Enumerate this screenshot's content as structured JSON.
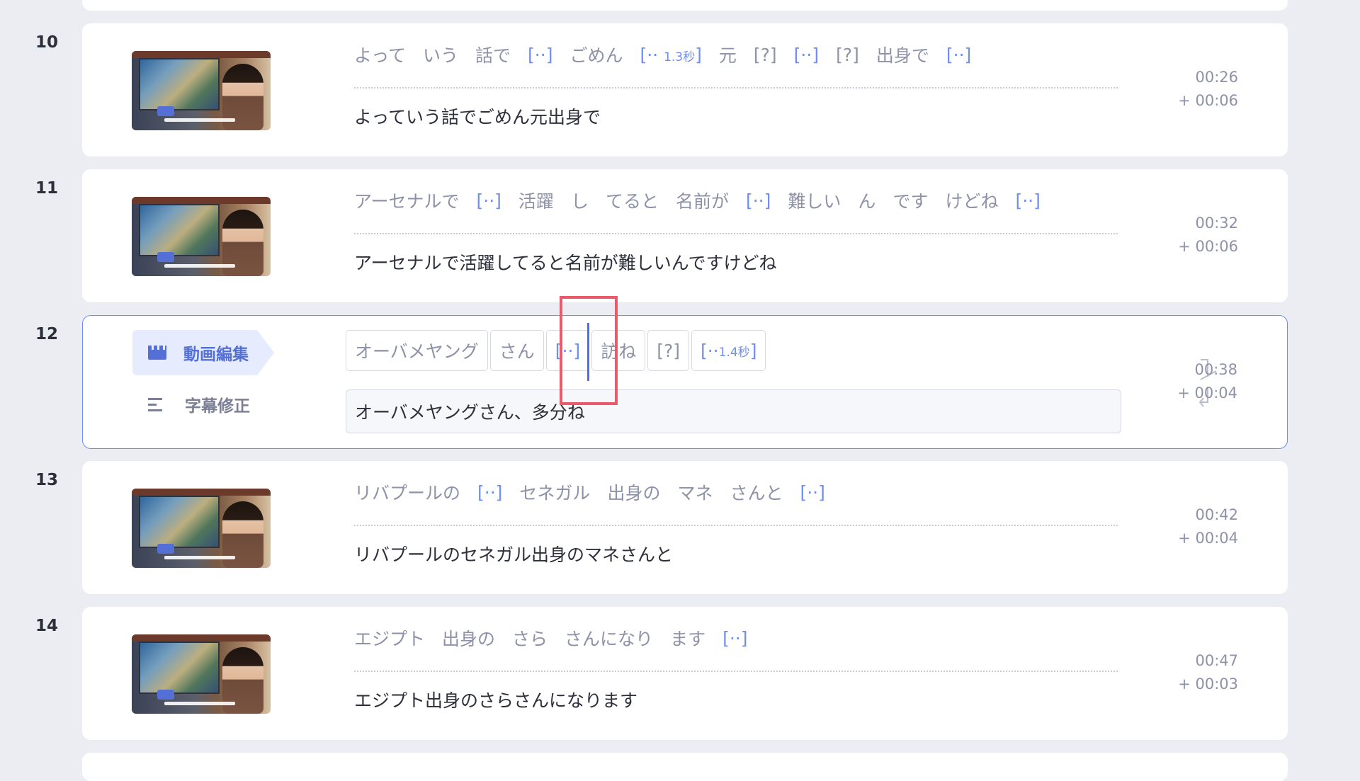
{
  "rows": [
    {
      "num": "10",
      "tokens": [
        "よって",
        "いう",
        "話で",
        "[··]",
        "ごめん",
        "[·· 1.3秒]",
        "元",
        "[?]",
        "[··]",
        "[?]",
        "出身で",
        "[··]"
      ],
      "text": "よっていう話でごめん元出身で",
      "time": "00:26",
      "duration": "+ 00:06"
    },
    {
      "num": "11",
      "tokens": [
        "アーセナルで",
        "[··]",
        "活躍",
        "し",
        "てると",
        "名前が",
        "[··]",
        "難しい",
        "ん",
        "です",
        "けどね",
        "[··]"
      ],
      "text": "アーセナルで活躍してると名前が難しいんですけどね",
      "time": "00:32",
      "duration": "+ 00:06"
    },
    {
      "num": "12",
      "mode_video": "動画編集",
      "mode_subtitle": "字幕修正",
      "tokens": [
        "オーバメヤング",
        "さん",
        "[··]",
        "訪ね",
        "[?]",
        "[·· 1.4秒]"
      ],
      "text": "オーバメヤングさん、多分ね",
      "time": "00:38",
      "duration": "+ 00:04"
    },
    {
      "num": "13",
      "tokens": [
        "リバプールの",
        "[··]",
        "セネガル",
        "出身の",
        "マネ",
        "さんと",
        "[··]"
      ],
      "text": "リバプールのセネガル出身のマネさんと",
      "time": "00:42",
      "duration": "+ 00:04"
    },
    {
      "num": "14",
      "tokens": [
        "エジプト",
        "出身の",
        "さら",
        "さんになり",
        "ます",
        "[··]"
      ],
      "text": "エジプト出身のさらさんになります",
      "time": "00:47",
      "duration": "+ 00:03"
    }
  ],
  "colors": {
    "accent": "#6f8ef0",
    "highlight": "#ea5a6a"
  },
  "icons": {
    "video_edit": "clapperboard-icon",
    "subtitle_edit": "text-lines-icon",
    "merge": "merge-rows-icon"
  }
}
